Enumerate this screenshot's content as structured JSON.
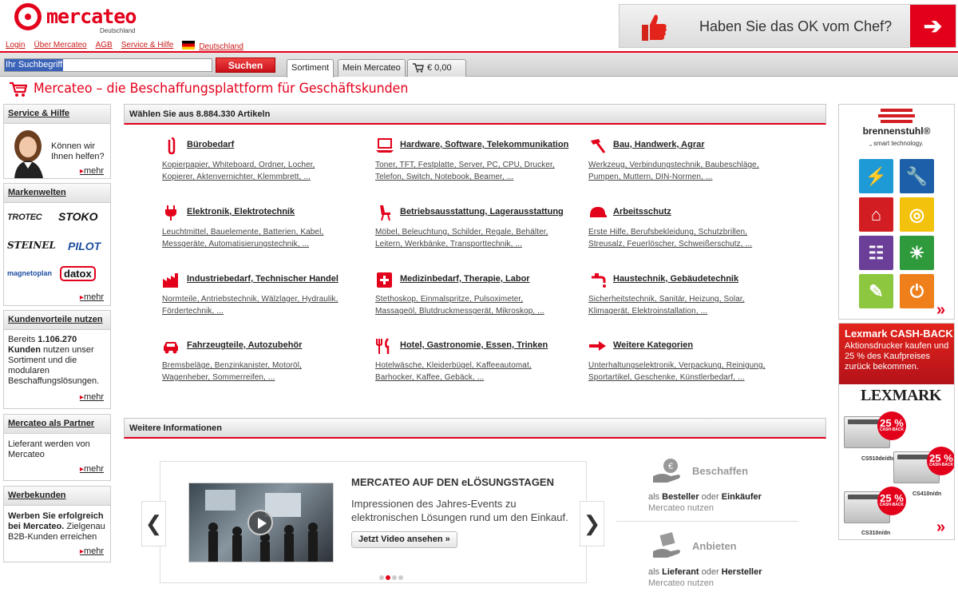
{
  "header": {
    "logo_text": "mercateo",
    "logo_sub": "Deutschland",
    "links": [
      "Login",
      "Über Mercateo",
      "AGB",
      "Service & Hilfe"
    ],
    "country": "Deutschland",
    "banner_text": "Haben Sie das OK vom Chef?",
    "banner_arrow": "➔"
  },
  "search": {
    "placeholder": "Ihr Suchbegriff",
    "button": "Suchen",
    "tabs": [
      "Sortiment",
      "Mein Mercateo",
      "€ 0,00"
    ],
    "active_tab": "Sortiment"
  },
  "page_title": "Mercateo – die Beschaffungsplattform für Geschäftskunden",
  "sidebar": {
    "service": {
      "title": "Service & Hilfe",
      "text": "Können wir Ihnen helfen?",
      "more": "mehr"
    },
    "marken": {
      "title": "Markenwelten",
      "brands": [
        "TROTEC",
        "STOKO",
        "STEINEL",
        "PILOT",
        "magnetoplan",
        "datox"
      ],
      "more": "mehr"
    },
    "vorteile": {
      "title": "Kundenvorteile nutzen",
      "text_pre": "Bereits ",
      "count": "1.106.270",
      "text_bold": "Kunden",
      "text_post": " nutzen unser Sortiment und die modularen Beschaffungslösungen.",
      "more": "mehr"
    },
    "partner": {
      "title": "Mercateo als Partner",
      "text": "Lieferant werden von Mercateo",
      "more": "mehr"
    },
    "werbe": {
      "title": "Werbekunden",
      "text_bold": "Werben Sie erfolgreich bei Mercateo.",
      "text": " Zielgenau B2B-Kunden erreichen",
      "more": "mehr"
    }
  },
  "main": {
    "section_title": "Wählen Sie aus 8.884.330 Artikeln",
    "categories": [
      {
        "name": "Bürobedarf",
        "l1": "Kopierpapier, Whiteboard, Ordner, Locher,",
        "l2": "Kopierer, Aktenvernichter, Klemmbrett, ...",
        "icon": "paperclip-icon"
      },
      {
        "name": "Hardware, Software, Telekommunikation",
        "l1": "Toner, TFT, Festplatte, Server, PC, CPU, Drucker,",
        "l2": "Telefon, Switch, Notebook, Beamer, ...",
        "icon": "laptop-icon"
      },
      {
        "name": "Bau, Handwerk, Agrar",
        "l1": "Werkzeug, Verbindungstechnik, Baubeschläge,",
        "l2": "Pumpen, Muttern, DIN-Normen, ...",
        "icon": "hammer-icon"
      },
      {
        "name": "Elektronik, Elektrotechnik",
        "l1": "Leuchtmittel, Bauelemente, Batterien, Kabel,",
        "l2": "Messgeräte, Automatisierungstechnik, ...",
        "icon": "plug-icon"
      },
      {
        "name": "Betriebsausstattung, Lagerausstattung",
        "l1": "Möbel, Beleuchtung, Schilder, Regale, Behälter,",
        "l2": "Leitern, Werkbänke, Transporttechnik, ...",
        "icon": "chair-icon"
      },
      {
        "name": "Arbeitsschutz",
        "l1": "Erste Hilfe, Berufsbekleidung, Schutzbrillen,",
        "l2": "Streusalz, Feuerlöscher, Schweißerschutz, ...",
        "icon": "helmet-icon"
      },
      {
        "name": "Industriebedarf, Technischer Handel",
        "l1": "Normteile, Antriebstechnik, Wälzlager, Hydraulik,",
        "l2": "Fördertechnik, ...",
        "icon": "factory-icon"
      },
      {
        "name": "Medizinbedarf, Therapie, Labor",
        "l1": "Stethoskop, Einmalspritze, Pulsoximeter,",
        "l2": "Massageöl, Blutdruckmessgerät, Mikroskop, ...",
        "icon": "medical-cross-icon"
      },
      {
        "name": "Haustechnik, Gebäudetechnik",
        "l1": "Sicherheitstechnik, Sanitär, Heizung, Solar,",
        "l2": "Klimagerät, Elektroinstallation, ...",
        "icon": "faucet-icon"
      },
      {
        "name": "Fahrzeugteile, Autozubehör",
        "l1": "Bremsbeläge, Benzinkanister, Motoröl,",
        "l2": "Wagenheber, Sommerreifen, ...",
        "icon": "car-icon"
      },
      {
        "name": "Hotel, Gastronomie, Essen, Trinken",
        "l1": "Hotelwäsche, Kleiderbügel, Kaffeeautomat,",
        "l2": "Barhocker, Kaffee, Gebäck, ...",
        "icon": "cutlery-icon"
      },
      {
        "name": "Weitere Kategorien",
        "l1": "Unterhaltungselektronik, Verpackung, Reinigung,",
        "l2": "Sportartikel, Geschenke, Künstlerbedarf, ...",
        "icon": "arrow-right-icon"
      }
    ]
  },
  "info": {
    "section_title": "Weitere Informationen",
    "slide": {
      "title": "MERCATEO AUF DEN eLÖSUNGSTAGEN",
      "desc": "Impressionen des Jahres-Events zu elektronischen Lösungen rund um den Einkauf.",
      "button": "Jetzt Video ansehen »",
      "prev": "❮",
      "next": "❯"
    },
    "actions": [
      {
        "title": "Beschaffen",
        "pre": "als ",
        "b1": "Besteller",
        "mid": " oder ",
        "b2": "Einkäufer",
        "note": "Mercateo nutzen",
        "icon": "hand-money-icon"
      },
      {
        "title": "Anbieten",
        "pre": "als ",
        "b1": "Lieferant",
        "mid": " oder ",
        "b2": "Hersteller",
        "note": "Mercateo nutzen",
        "icon": "hand-box-icon"
      }
    ]
  },
  "ads": {
    "brennenstuhl": {
      "name": "brennenstuhl®",
      "tagline": "„ smart technology."
    },
    "lexmark": {
      "title": "Lexmark CASH-BACK",
      "text": "Aktionsdrucker kaufen und 25 % des Kaufpreises zurück bekommen.",
      "brand": "LEXMARK",
      "badge": "25 %",
      "badge_sub": "CASH-BACK",
      "models": [
        "CS510de/dte",
        "CS410n/dn",
        "CS310n/dn"
      ]
    }
  },
  "colors": {
    "brand_red": "#e3001b"
  }
}
